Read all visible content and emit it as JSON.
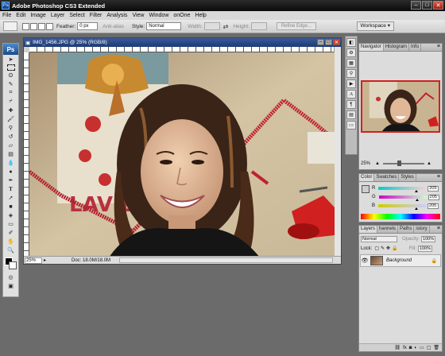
{
  "app": {
    "title": "Adobe Photoshop CS3 Extended",
    "logo": "Ps"
  },
  "window_buttons": [
    "–",
    "□",
    "✕"
  ],
  "menu": [
    "File",
    "Edit",
    "Image",
    "Layer",
    "Select",
    "Filter",
    "Analysis",
    "View",
    "Window",
    "onOne",
    "Help"
  ],
  "options": {
    "feather_label": "Feather:",
    "feather_value": "0 px",
    "antialias_label": "Anti-alias",
    "style_label": "Style:",
    "style_value": "Normal",
    "width_label": "Width:",
    "height_label": "Height:",
    "refine_label": "Refine Edge...",
    "workspace_label": "Workspace ▾"
  },
  "document": {
    "title": "IMG_1456.JPG @ 25% (RGB/8)",
    "zoom": "25%",
    "doc_size": "Doc: 18.0M/18.0M"
  },
  "navigator": {
    "tabs": [
      "Navigator",
      "Histogram",
      "Info"
    ],
    "zoom": "25%"
  },
  "color_panel": {
    "tabs": [
      "Color",
      "Swatches",
      "Styles"
    ],
    "channels": [
      {
        "label": "R",
        "value": "205",
        "gradient": "linear-gradient(90deg,#00cdcd,#ffcdcd)",
        "fraction": 0.8
      },
      {
        "label": "G",
        "value": "205",
        "gradient": "linear-gradient(90deg,#cd00cd,#cdffcd)",
        "fraction": 0.8
      },
      {
        "label": "B",
        "value": "205",
        "gradient": "linear-gradient(90deg,#cdcd00,#cdcdff)",
        "fraction": 0.8
      }
    ]
  },
  "layers": {
    "tabs": [
      "Layers",
      "hannels",
      "Paths",
      "istory"
    ],
    "blend_mode": "Normal",
    "opacity_label": "Opacity:",
    "opacity_value": "100%",
    "lock_label": "Lock:",
    "fill_label": "Fill:",
    "fill_value": "100%",
    "layer_name": "Background"
  }
}
